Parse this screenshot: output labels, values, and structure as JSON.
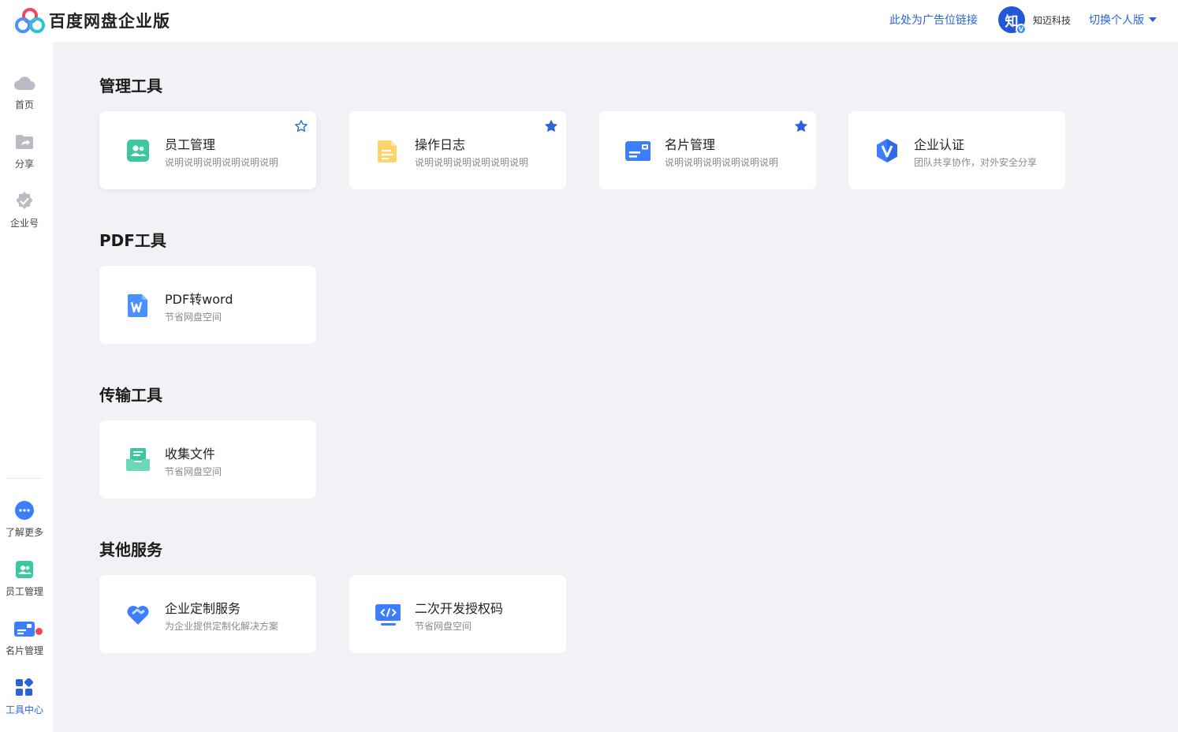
{
  "header": {
    "app_title": "百度网盘企业版",
    "ad_link": "此处为广告位链接",
    "avatar_text": "知",
    "avatar_badge": "V",
    "company_name": "知迈科技",
    "switch_label": "切换个人版"
  },
  "sidebar": {
    "top_items": [
      {
        "label": "首页",
        "icon": "cloud-icon"
      },
      {
        "label": "分享",
        "icon": "share-folder-icon"
      },
      {
        "label": "企业号",
        "icon": "verified-badge-icon"
      }
    ],
    "bottom_items": [
      {
        "label": "了解更多",
        "icon": "more-chat-icon"
      },
      {
        "label": "员工管理",
        "icon": "staff-icon"
      },
      {
        "label": "名片管理",
        "icon": "card-icon"
      },
      {
        "label": "工具中心",
        "icon": "apps-grid-icon",
        "active": true
      }
    ]
  },
  "sections": [
    {
      "title": "管理工具",
      "cards": [
        {
          "name": "员工管理",
          "desc": "说明说明说明说明说明说明",
          "icon": "staff-icon",
          "star": "outline"
        },
        {
          "name": "操作日志",
          "desc": "说明说明说明说明说明说明",
          "icon": "document-icon",
          "star": "filled"
        },
        {
          "name": "名片管理",
          "desc": "说明说明说明说明说明说明",
          "icon": "card-icon",
          "star": "filled"
        },
        {
          "name": "企业认证",
          "desc": "团队共享协作，对外安全分享",
          "icon": "verify-v-icon",
          "star": "none"
        }
      ]
    },
    {
      "title": "PDF工具",
      "cards": [
        {
          "name": "PDF转word",
          "desc": "节省网盘空间",
          "icon": "word-icon",
          "star": "none"
        }
      ]
    },
    {
      "title": "传输工具",
      "cards": [
        {
          "name": "收集文件",
          "desc": "节省网盘空间",
          "icon": "inbox-icon",
          "star": "none"
        }
      ]
    },
    {
      "title": "其他服务",
      "cards": [
        {
          "name": "企业定制服务",
          "desc": "为企业提供定制化解决方案",
          "icon": "heart-handshake-icon",
          "star": "none"
        },
        {
          "name": "二次开发授权码",
          "desc": "节省网盘空间",
          "icon": "code-monitor-icon",
          "star": "none"
        }
      ]
    }
  ],
  "colors": {
    "accent": "#2b63d9",
    "background": "#f1f2f6",
    "badge": "#f2455a"
  }
}
